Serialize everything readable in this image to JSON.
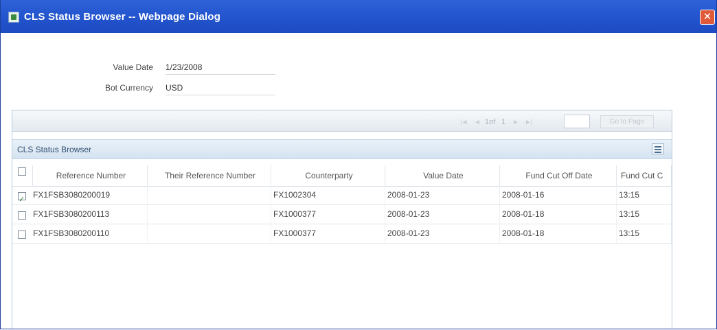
{
  "window": {
    "title": "CLS Status Browser -- Webpage Dialog",
    "close_label": "✕"
  },
  "form": {
    "value_date_label": "Value Date",
    "value_date": "1/23/2008",
    "currency_label": "Bot Currency",
    "currency": "USD"
  },
  "pager": {
    "first": "|◄",
    "prev": "◄",
    "page_text": "1of",
    "total": "1",
    "next": "►",
    "last": "►|",
    "goto_page_value": "",
    "goto_label": "Go to Page"
  },
  "grid": {
    "title": "CLS Status Browser",
    "columns": [
      "Reference Number",
      "Their Reference Number",
      "Counterparty",
      "Value Date",
      "Fund Cut Off Date",
      "Fund Cut C"
    ],
    "rows": [
      {
        "checked": true,
        "reference": "FX1FSB3080200019",
        "their_reference": "",
        "counterparty": "FX1002304",
        "value_date": "2008-01-23",
        "fund_cut_off_date": "2008-01-16",
        "fund_cut_off_time": "13:15"
      },
      {
        "checked": false,
        "reference": "FX1FSB3080200113",
        "their_reference": "",
        "counterparty": "FX1000377",
        "value_date": "2008-01-23",
        "fund_cut_off_date": "2008-01-18",
        "fund_cut_off_time": "13:15"
      },
      {
        "checked": false,
        "reference": "FX1FSB3080200110",
        "their_reference": "",
        "counterparty": "FX1000377",
        "value_date": "2008-01-23",
        "fund_cut_off_date": "2008-01-18",
        "fund_cut_off_time": "13:15"
      }
    ]
  },
  "colors": {
    "titlebar": "#2456cf",
    "grid_header": "#d5e3f1",
    "close_button": "#e05a3a"
  }
}
